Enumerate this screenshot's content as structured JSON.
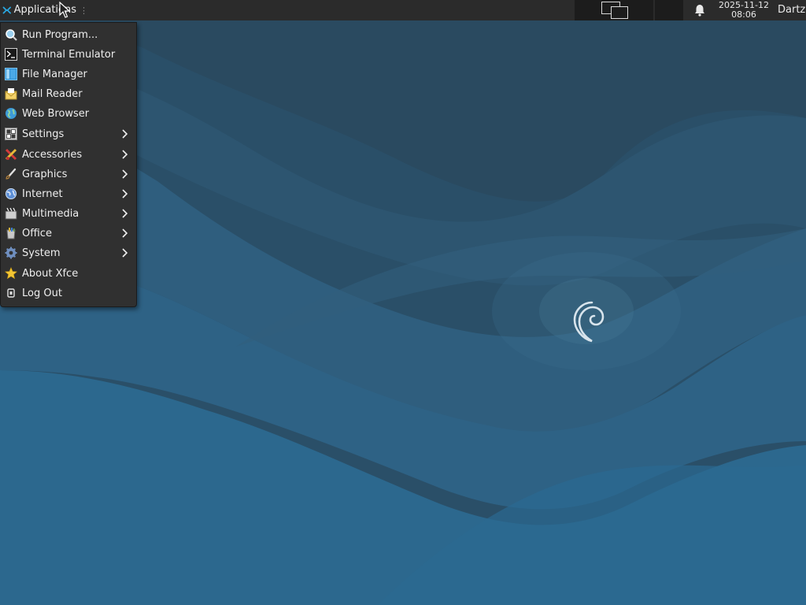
{
  "panel": {
    "applications_label": "Applications",
    "clock_date": "2025-11-12",
    "clock_time": "08:06",
    "user_name": "Dartz"
  },
  "menu": {
    "items": [
      {
        "label": "Run Program...",
        "icon": "run-program-icon",
        "submenu": false
      },
      {
        "label": "Terminal Emulator",
        "icon": "terminal-icon",
        "submenu": false
      },
      {
        "label": "File Manager",
        "icon": "file-manager-icon",
        "submenu": false
      },
      {
        "label": "Mail Reader",
        "icon": "mail-icon",
        "submenu": false
      },
      {
        "label": "Web Browser",
        "icon": "web-browser-icon",
        "submenu": false
      },
      {
        "label": "Settings",
        "icon": "settings-icon",
        "submenu": true
      },
      {
        "label": "Accessories",
        "icon": "accessories-icon",
        "submenu": true
      },
      {
        "label": "Graphics",
        "icon": "graphics-icon",
        "submenu": true
      },
      {
        "label": "Internet",
        "icon": "internet-icon",
        "submenu": true
      },
      {
        "label": "Multimedia",
        "icon": "multimedia-icon",
        "submenu": true
      },
      {
        "label": "Office",
        "icon": "office-icon",
        "submenu": true
      },
      {
        "label": "System",
        "icon": "system-icon",
        "submenu": true
      },
      {
        "label": "About Xfce",
        "icon": "star-icon",
        "submenu": false
      },
      {
        "label": "Log Out",
        "icon": "logout-icon",
        "submenu": false
      }
    ]
  },
  "colors": {
    "panel_bg": "#2b2b2b",
    "menu_bg": "#303030",
    "desktop_bg": "#2c5a78"
  }
}
